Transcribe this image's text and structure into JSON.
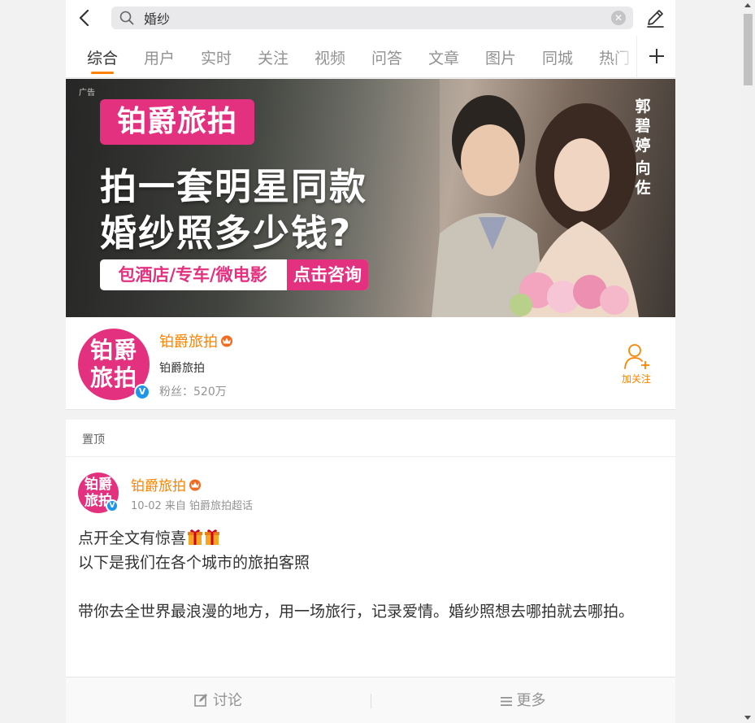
{
  "search": {
    "query": "婚纱"
  },
  "tabs": [
    {
      "label": "综合",
      "active": true
    },
    {
      "label": "用户"
    },
    {
      "label": "实时"
    },
    {
      "label": "关注"
    },
    {
      "label": "视频"
    },
    {
      "label": "问答"
    },
    {
      "label": "文章"
    },
    {
      "label": "图片"
    },
    {
      "label": "同城"
    },
    {
      "label": "热门"
    }
  ],
  "banner": {
    "ad_label": "广告",
    "brand": "铂爵旅拍",
    "headline_1": "拍一套明星同款",
    "headline_2": "婚纱照多少钱?",
    "services": "包酒店/专车/微电影",
    "cta": "点击咨询",
    "celebrity_1": [
      "郭",
      "碧",
      "婷"
    ],
    "celebrity_2": [
      "向",
      "佐"
    ]
  },
  "account": {
    "avatar_text_1": "铂爵",
    "avatar_text_2": "旅拍",
    "name": "铂爵旅拍",
    "subtitle": "铂爵旅拍",
    "fans": "粉丝：520万",
    "follow_label": "加关注"
  },
  "pinned": {
    "label": "置顶",
    "author": "铂爵旅拍",
    "meta": "10-02 来自 铂爵旅拍超话",
    "lines": [
      "点开全文有惊喜",
      "以下是我们在各个城市的旅拍客照",
      "",
      "带你去全世界最浪漫的地方，用一场旅行，记录爱情。婚纱照想去哪拍就去哪拍。"
    ],
    "actions": {
      "discuss": "讨论",
      "more": "更多"
    }
  },
  "colors": {
    "accent": "#ff8200",
    "brand_pink": "#e4317f",
    "verified_blue": "#1d95ec"
  }
}
